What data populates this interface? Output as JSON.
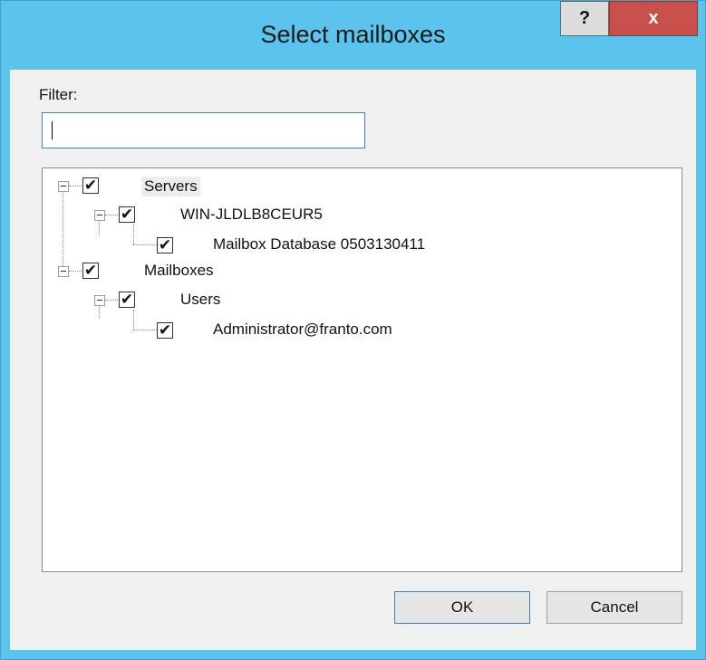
{
  "window": {
    "title": "Select mailboxes"
  },
  "titlebar": {
    "help_label": "?",
    "close_label": "x"
  },
  "filter": {
    "label": "Filter:",
    "value": ""
  },
  "tree": {
    "items": [
      {
        "label": "Servers",
        "checked": true
      },
      {
        "label": "WIN-JLDLB8CEUR5",
        "checked": true
      },
      {
        "label": "Mailbox Database 0503130411",
        "checked": true
      },
      {
        "label": "Mailboxes",
        "checked": true
      },
      {
        "label": "Users",
        "checked": true
      },
      {
        "label": "Administrator@franto.com",
        "checked": true
      }
    ]
  },
  "buttons": {
    "ok_label": "OK",
    "cancel_label": "Cancel"
  },
  "icons": {
    "checkbox_checked": "✔"
  }
}
